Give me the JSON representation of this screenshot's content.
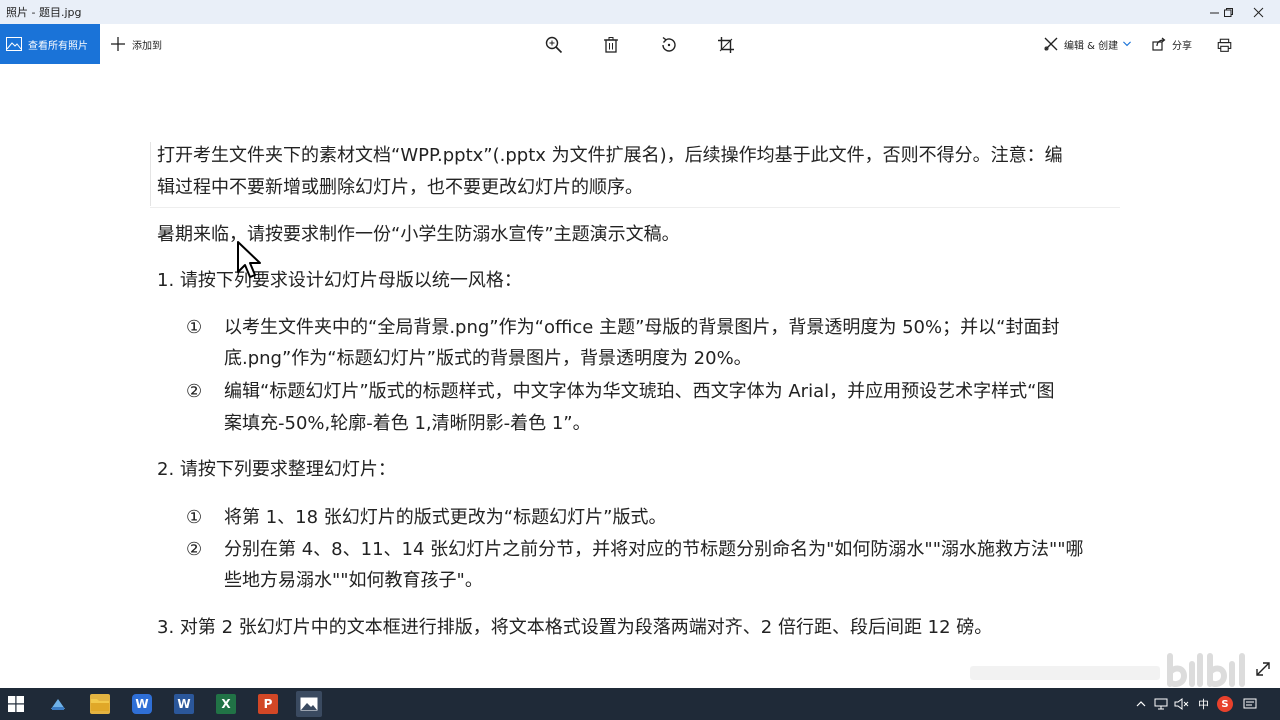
{
  "window": {
    "title": "照片 - 题目.jpg"
  },
  "toolbar": {
    "view_all_label": "查看所有照片",
    "add_to_label": "添加到",
    "edit_create_label": "编辑 & 创建",
    "share_label": "分享",
    "tools": [
      "zoom-icon",
      "delete-icon",
      "rotate-icon",
      "crop-icon",
      "print-icon"
    ]
  },
  "document": {
    "lines": [
      "打开考生文件夹下的素材文档“WPP.pptx”(.pptx 为文件扩展名)，后续操作均基于此文件，否则不得分。注意：编",
      "辑过程中不要新增或删除幻灯片，也不要更改幻灯片的顺序。",
      "暑期来临，请按要求制作一份“小学生防溺水宣传”主题演示文稿。",
      "1. 请按下列要求设计幻灯片母版以统一风格：",
      "以考生文件夹中的“全局背景.png”作为“office 主题”母版的背景图片，背景透明度为 50%；并以“封面封",
      "底.png”作为“标题幻灯片”版式的背景图片，背景透明度为 20%。",
      "编辑“标题幻灯片”版式的标题样式，中文字体为华文琥珀、西文字体为 Arial，并应用预设艺术字样式“图",
      "案填充-50%,轮廓-着色 1,清晰阴影-着色 1”。",
      "2. 请按下列要求整理幻灯片：",
      "将第 1、18 张幻灯片的版式更改为“标题幻灯片”版式。",
      "分别在第 4、8、11、14 张幻灯片之前分节，并将对应的节标题分别命名为\"如何防溺水\"\"溺水施救方法\"\"哪",
      "些地方易溺水\"\"如何教育孩子\"。",
      "3. 对第 2 张幻灯片中的文本框进行排版，将文本格式设置为段落两端对齐、2 倍行距、段后间距 12 磅。"
    ],
    "markers": [
      "①",
      "②",
      "①",
      "②"
    ]
  },
  "taskbar": {
    "apps": [
      {
        "name": "file-explorer",
        "glyph": ""
      },
      {
        "name": "wps-writer",
        "glyph": "W"
      },
      {
        "name": "word",
        "glyph": "W"
      },
      {
        "name": "excel",
        "glyph": "X"
      },
      {
        "name": "powerpoint",
        "glyph": "P"
      },
      {
        "name": "photos",
        "glyph": ""
      }
    ],
    "ime_label": "中",
    "sogou_label": "S"
  },
  "colors": {
    "accent": "#1a73d8",
    "taskbar": "#1f2a38",
    "titlebar": "#e9eff8"
  }
}
